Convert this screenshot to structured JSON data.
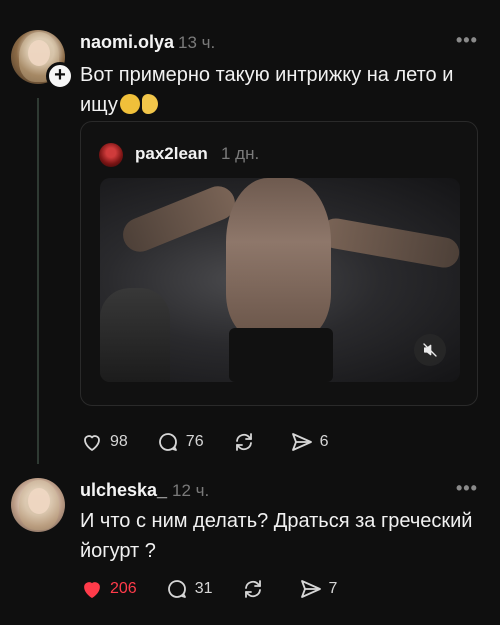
{
  "posts": [
    {
      "username": "naomi.olya",
      "time": "13 ч.",
      "text": "Вот примерно такую интрижку на лето и\nищу",
      "emoji_icons": [
        "smirking-face-icon",
        "pinching-hand-icon"
      ],
      "quote": {
        "username": "pax2lean",
        "time": "1 дн.",
        "media_icon": "muted-speaker-icon"
      },
      "actions": {
        "likes": "98",
        "comments": "76",
        "reposts": "",
        "shares": "6"
      }
    },
    {
      "username": "ulcheska_",
      "time": "12 ч.",
      "text": "И что с ним делать? Драться за греческий\nйогурт ?",
      "actions": {
        "likes": "206",
        "comments": "31",
        "reposts": "",
        "shares": "7"
      }
    }
  ],
  "colors": {
    "like_active": "#ff3b4a",
    "background": "#0f0f0f",
    "text": "#f3f3f3",
    "muted": "#7a7a7a"
  }
}
